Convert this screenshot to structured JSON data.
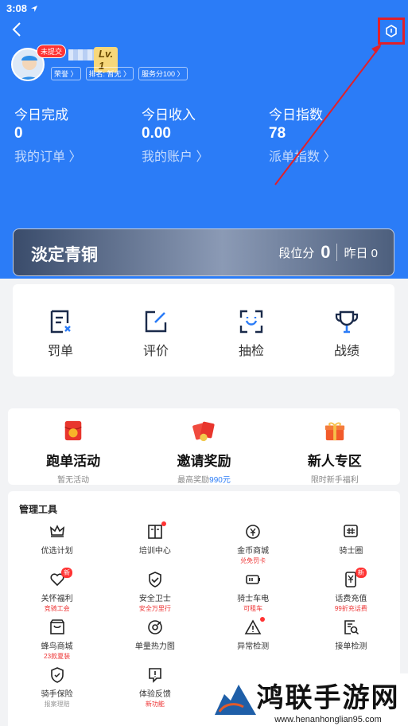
{
  "status": {
    "time": "3:08"
  },
  "profile": {
    "badge": "未提交",
    "level": "Lv. 1",
    "chips": [
      "荣誉 〉",
      "排名: 暂无 〉",
      "服务分100 〉"
    ]
  },
  "stats": [
    {
      "label": "今日完成",
      "value": "0",
      "link": "我的订单 〉"
    },
    {
      "label": "今日收入",
      "value": "0.00",
      "link": "我的账户 〉"
    },
    {
      "label": "今日指数",
      "value": "78",
      "link": "派单指数 〉"
    }
  ],
  "rank": {
    "title": "淡定青铜",
    "score_label": "段位分",
    "score": "0",
    "yesterday": "昨日 0"
  },
  "tools": [
    {
      "label": "罚单",
      "icon": "ticket-icon"
    },
    {
      "label": "评价",
      "icon": "edit-icon"
    },
    {
      "label": "抽检",
      "icon": "face-scan-icon"
    },
    {
      "label": "战绩",
      "icon": "trophy-icon"
    }
  ],
  "promos": [
    {
      "title": "跑单活动",
      "sub": "暂无活动",
      "color": "#e8362d"
    },
    {
      "title": "邀请奖励",
      "sub": "最高奖励",
      "highlight": "990元",
      "color": "#f04a3e"
    },
    {
      "title": "新人专区",
      "sub": "限时新手福利",
      "color": "#f25a2a"
    }
  ],
  "management": {
    "title": "管理工具",
    "items": [
      {
        "name": "优选计划",
        "sub": "",
        "icon": "crown-icon"
      },
      {
        "name": "培训中心",
        "sub": "",
        "icon": "book-icon",
        "dot": true
      },
      {
        "name": "金币商城",
        "sub": "兑免罚卡",
        "icon": "coin-icon"
      },
      {
        "name": "骑士圈",
        "sub": "",
        "icon": "hash-icon"
      },
      {
        "name": "关怀福利",
        "sub": "竞骑工会",
        "icon": "heart-icon",
        "new": "新"
      },
      {
        "name": "安全卫士",
        "sub": "安全万里行",
        "icon": "shield-icon"
      },
      {
        "name": "骑士车电",
        "sub": "可租车",
        "icon": "battery-icon"
      },
      {
        "name": "话费充值",
        "sub": "99折充话费",
        "icon": "phone-recharge-icon",
        "new": "新"
      },
      {
        "name": "蜂鸟商城",
        "sub": "23款夏装",
        "icon": "shop-icon"
      },
      {
        "name": "单量热力图",
        "sub": "",
        "icon": "heatmap-icon"
      },
      {
        "name": "异常检测",
        "sub": "",
        "icon": "warning-icon",
        "dot": true
      },
      {
        "name": "接单检测",
        "sub": "",
        "icon": "order-check-icon"
      },
      {
        "name": "骑手保险",
        "sub": "报案理赔",
        "icon": "insurance-icon",
        "subgray": true
      },
      {
        "name": "体验反馈",
        "sub": "新功能",
        "icon": "feedback-icon"
      }
    ]
  },
  "watermark": {
    "title": "鸿联手游网",
    "url": "www.henanhonglian95.com"
  }
}
